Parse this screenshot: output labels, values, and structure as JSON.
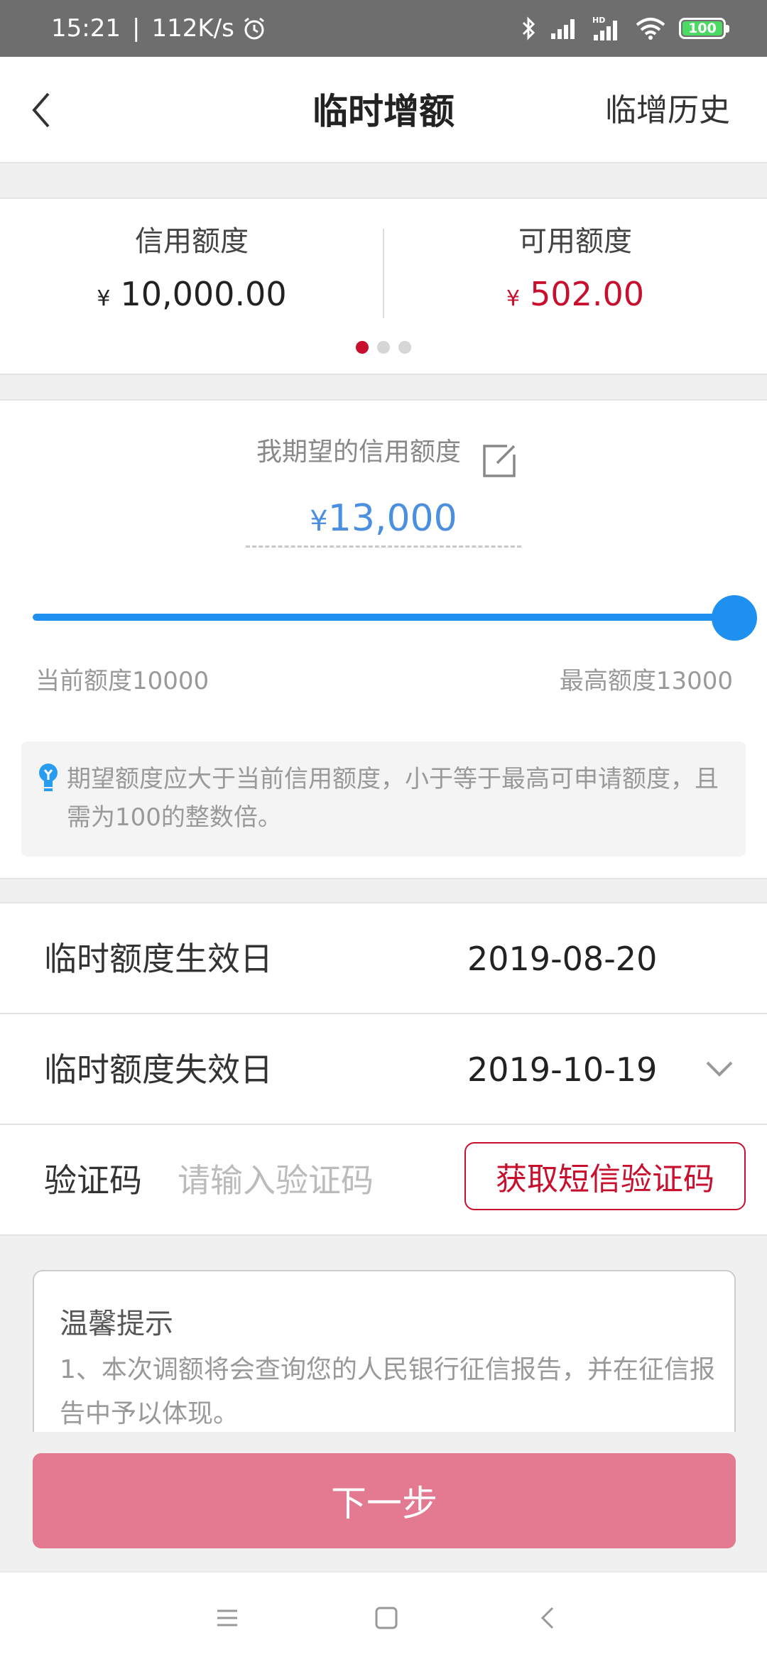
{
  "status_bar": {
    "time": "15:21",
    "net_speed": "112K/s",
    "battery": "100",
    "icons": [
      "alarm-icon",
      "bluetooth-icon",
      "signal-icon",
      "hd-signal-icon",
      "wifi-icon",
      "battery-icon"
    ]
  },
  "nav": {
    "title": "临时增额",
    "history": "临增历史",
    "back_icon": "chevron-left-icon"
  },
  "limits": {
    "credit_label": "信用额度",
    "credit_currency": "¥",
    "credit_value": "10,000.00",
    "available_label": "可用额度",
    "available_currency": "¥",
    "available_value": "502.00",
    "pager": {
      "count": 3,
      "active": 1
    }
  },
  "expect": {
    "label": "我期望的信用额度",
    "currency": "¥",
    "amount": "13,000",
    "slider": {
      "min": 10000,
      "max": 13000,
      "value": 13000
    },
    "range_min_text": "当前额度10000",
    "range_max_text": "最高额度13000",
    "tip": "期望额度应大于当前信用额度，小于等于最高可申请额度，且需为100的整数倍。"
  },
  "form": {
    "effective_label": "临时额度生效日",
    "effective_date": "2019-08-20",
    "expiry_label": "临时额度失效日",
    "expiry_date": "2019-10-19",
    "code_label": "验证码",
    "code_placeholder": "请输入验证码",
    "sms_button": "获取短信验证码"
  },
  "notice": {
    "title": "温馨提示",
    "body": "1、本次调额将会查询您的人民银行征信报告，并在征信报告中予以体现。"
  },
  "next_button": "下一步",
  "colors": {
    "accent_red": "#c8102e",
    "slider_blue": "#1e90f0",
    "amount_blue": "#4a8fe0",
    "next_button_bg": "#e37a91"
  }
}
